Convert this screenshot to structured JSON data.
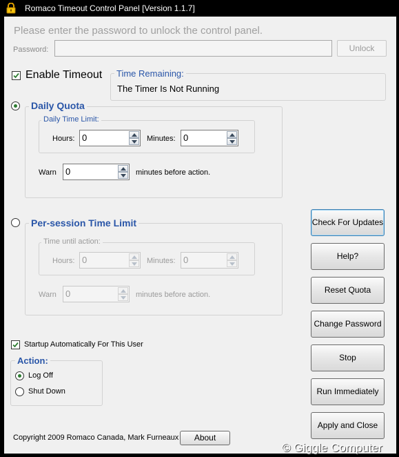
{
  "window": {
    "title": "Romaco Timeout Control Panel [Version 1.1.7]"
  },
  "unlock": {
    "prompt": "Please enter the password to unlock the control panel.",
    "password_label": "Password:",
    "password_value": "",
    "unlock_label": "Unlock"
  },
  "timeout": {
    "enable_label": "Enable Timeout",
    "enable_checked": true,
    "time_remaining_label": "Time Remaining:",
    "time_remaining_value": "The Timer Is Not Running"
  },
  "daily": {
    "label": "Daily Quota",
    "selected": true,
    "limit_label": "Daily Time Limit:",
    "hours_label": "Hours:",
    "hours_value": "0",
    "minutes_label": "Minutes:",
    "minutes_value": "0",
    "warn_label": "Warn",
    "warn_value": "0",
    "warn_suffix": "minutes before action."
  },
  "session": {
    "label": "Per-session Time Limit",
    "selected": false,
    "until_label": "Time until action:",
    "hours_label": "Hours:",
    "hours_value": "0",
    "minutes_label": "Minutes:",
    "minutes_value": "0",
    "warn_label": "Warn",
    "warn_value": "0",
    "warn_suffix": "minutes before action."
  },
  "startup": {
    "label": "Startup Automatically For This User",
    "checked": true
  },
  "action": {
    "label": "Action:",
    "options": [
      {
        "label": "Log Off",
        "selected": true
      },
      {
        "label": "Shut Down",
        "selected": false
      }
    ]
  },
  "buttons": {
    "check_updates": "Check For Updates",
    "help": "Help?",
    "reset_quota": "Reset Quota",
    "change_password": "Change Password",
    "stop": "Stop",
    "run_immediately": "Run Immediately",
    "apply_close": "Apply and Close",
    "about": "About"
  },
  "footer": {
    "copyright": "Copyright 2009 Romaco Canada, Mark Furneaux",
    "watermark": "© Giggle Computer"
  },
  "colors": {
    "accent": "#2a56a8",
    "radio_on": "#2e7d32",
    "background": "#f0f0f0"
  }
}
